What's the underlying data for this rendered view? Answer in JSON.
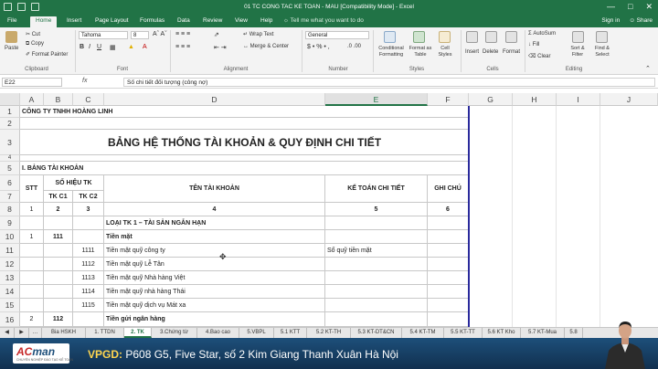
{
  "window": {
    "title": "01 TC CONG TAC KE TOAN - MAU  [Compatibility Mode] - Excel"
  },
  "menu": {
    "file": "File",
    "tabs": [
      "Home",
      "Insert",
      "Page Layout",
      "Formulas",
      "Data",
      "Review",
      "View",
      "Help"
    ],
    "tell": "Tell me what you want to do",
    "signin": "Sign in",
    "share": "Share"
  },
  "ribbon": {
    "clipboard": {
      "paste": "Paste",
      "cut": "Cut",
      "copy": "Copy",
      "painter": "Format Painter",
      "label": "Clipboard"
    },
    "font": {
      "name": "Tahoma",
      "size": "8",
      "label": "Font"
    },
    "alignment": {
      "wrap": "Wrap Text",
      "merge": "Merge & Center",
      "label": "Alignment"
    },
    "number": {
      "format": "General",
      "label": "Number"
    },
    "styles": {
      "conditional": "Conditional Formatting",
      "table": "Format as Table",
      "cell": "Cell Styles",
      "label": "Styles"
    },
    "cells": {
      "insert": "Insert",
      "delete": "Delete",
      "format": "Format",
      "label": "Cells"
    },
    "editing": {
      "autosum": "AutoSum",
      "fill": "Fill",
      "clear": "Clear",
      "sort": "Sort & Filter",
      "find": "Find & Select",
      "label": "Editing"
    }
  },
  "formula_bar": {
    "name_box": "E22",
    "fx": "fx",
    "content": "Số chi tiết đối tượng (công nợ)"
  },
  "columns": [
    "A",
    "B",
    "C",
    "D",
    "E",
    "F",
    "G",
    "H",
    "I",
    "J"
  ],
  "rows": {
    "r1": "CÔNG TY TNHH HOÀNG LINH",
    "r2": "",
    "r3": "BẢNG HỆ THỐNG TÀI KHOẢN & QUY ĐỊNH CHI TIẾT",
    "r4": "",
    "r5": "I. BẢNG TÀI KHOẢN",
    "hdr": {
      "stt": "STT",
      "sohieu": "SỐ HIỆU TK",
      "tkc1": "TK C1",
      "tkc2": "TK C2",
      "ten": "TÊN TÀI KHOẢN",
      "ketoan": "KẾ TOÁN CHI TIẾT",
      "ghichu": "GHI CHÚ"
    },
    "r8": [
      "1",
      "2",
      "3",
      "4",
      "5",
      "6"
    ],
    "r9": "LOẠI TK 1 – TÀI SẢN NGẮN HẠN",
    "r10": {
      "stt": "1",
      "c1": "111",
      "ten": "Tiền mặt"
    },
    "r11": {
      "c2": "1111",
      "ten": "Tiền mặt quỹ công ty",
      "ketoan": "Sổ quỹ tiền mặt"
    },
    "r12": {
      "c2": "1112",
      "ten": "Tiền mặt quỹ Lễ Tân"
    },
    "r13": {
      "c2": "1113",
      "ten": "Tiền mặt quỹ Nhà hàng Việt"
    },
    "r14": {
      "c2": "1114",
      "ten": "Tiền mặt quỹ nhà hàng Thái"
    },
    "r15": {
      "c2": "1115",
      "ten": "Tiền mặt quỹ dịch vụ Mát xa"
    },
    "r16": {
      "stt": "2",
      "c1": "112",
      "ten": "Tiền gửi ngân hàng"
    }
  },
  "row_numbers": [
    "1",
    "2",
    "3",
    "4",
    "5",
    "6",
    "7",
    "8",
    "9",
    "10",
    "11",
    "12",
    "13",
    "14",
    "15",
    "16"
  ],
  "sheet_tabs": [
    "Bia HSKH",
    "1. TTDN",
    "2. TK",
    "3.Chứng từ",
    "4.Bao cao",
    "5.VBPL",
    "5.1 KTT",
    "5.2 KT-TH",
    "5.3 KT-DT&CN",
    "5.4 KT-TM",
    "5.5 KT-TT",
    "5.6 KT Kho",
    "5.7 KT-Mua",
    "5.8"
  ],
  "banner": {
    "logo_ac": "AC",
    "logo_man": "man",
    "logo_sub": "CHUYÊN NGHIỆP ĐÀO TẠO KẾ TOÁN",
    "text_label": "VPGD:",
    "text": "P608 G5, Five Star, số 2 Kim Giang Thanh Xuân Hà Nội"
  },
  "colors": {
    "excel_green": "#217346",
    "banner_blue": "#1d4f7a"
  }
}
